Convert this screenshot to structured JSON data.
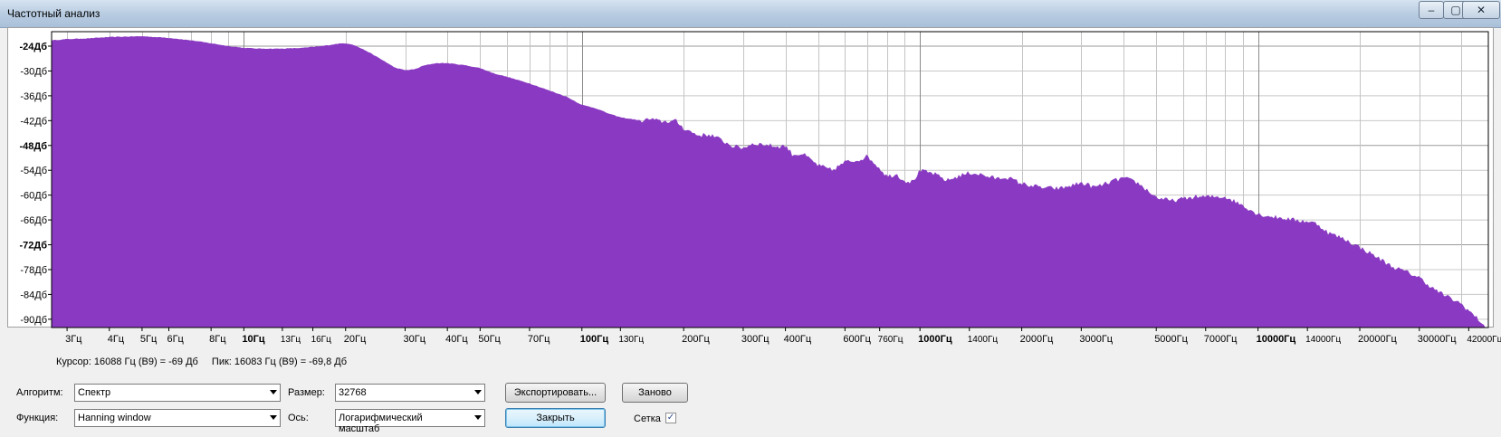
{
  "window": {
    "title": "Частотный анализ"
  },
  "window_buttons": {
    "minimize": "–",
    "maximize": "▢",
    "close": "✕"
  },
  "status": {
    "cursor": "Курсор: 16088 Гц (B9) = -69 Дб",
    "peak": "Пик: 16083 Гц (B9) = -69,8 Дб"
  },
  "controls": {
    "algorithm_label": "Алгоритм:",
    "algorithm_value": "Спектр",
    "function_label": "Функция:",
    "function_value": "Hanning window",
    "size_label": "Размер:",
    "size_value": "32768",
    "axis_label": "Ось:",
    "axis_value": "Логарифмический масштаб",
    "export_label": "Экспортировать...",
    "replot_label": "Заново",
    "close_label": "Закрыть",
    "grid_label": "Сетка",
    "grid_checked": true
  },
  "chart_data": {
    "type": "area",
    "x_scale": "log",
    "xlim": [
      2.7,
      48000
    ],
    "ylim": [
      -92,
      -20.5
    ],
    "grid": true,
    "fill_color": "#8a3ac2",
    "y_ticks": [
      {
        "value": -24,
        "label": "-24Дб",
        "bold": true
      },
      {
        "value": -30,
        "label": "-30Дб",
        "bold": false
      },
      {
        "value": -36,
        "label": "-36Дб",
        "bold": false
      },
      {
        "value": -42,
        "label": "-42Дб",
        "bold": false
      },
      {
        "value": -48,
        "label": "-48Дб",
        "bold": true
      },
      {
        "value": -54,
        "label": "-54Дб",
        "bold": false
      },
      {
        "value": -60,
        "label": "-60Дб",
        "bold": false
      },
      {
        "value": -66,
        "label": "-66Дб",
        "bold": false
      },
      {
        "value": -72,
        "label": "-72Дб",
        "bold": true
      },
      {
        "value": -78,
        "label": "-78Дб",
        "bold": false
      },
      {
        "value": -84,
        "label": "-84Дб",
        "bold": false
      },
      {
        "value": -90,
        "label": "-90Дб",
        "bold": false
      }
    ],
    "x_ticks": [
      {
        "value": 3,
        "label": "3Гц",
        "bold": false
      },
      {
        "value": 4,
        "label": "4Гц",
        "bold": false
      },
      {
        "value": 5,
        "label": "5Гц",
        "bold": false
      },
      {
        "value": 6,
        "label": "6Гц",
        "bold": false
      },
      {
        "value": 8,
        "label": "8Гц",
        "bold": false
      },
      {
        "value": 10,
        "label": "10Гц",
        "bold": true
      },
      {
        "value": 13,
        "label": "13Гц",
        "bold": false
      },
      {
        "value": 16,
        "label": "16Гц",
        "bold": false
      },
      {
        "value": 20,
        "label": "20Гц",
        "bold": false
      },
      {
        "value": 30,
        "label": "30Гц",
        "bold": false
      },
      {
        "value": 40,
        "label": "40Гц",
        "bold": false
      },
      {
        "value": 50,
        "label": "50Гц",
        "bold": false
      },
      {
        "value": 70,
        "label": "70Гц",
        "bold": false
      },
      {
        "value": 100,
        "label": "100Гц",
        "bold": true
      },
      {
        "value": 130,
        "label": "130Гц",
        "bold": false
      },
      {
        "value": 200,
        "label": "200Гц",
        "bold": false
      },
      {
        "value": 300,
        "label": "300Гц",
        "bold": false
      },
      {
        "value": 400,
        "label": "400Гц",
        "bold": false
      },
      {
        "value": 600,
        "label": "600Гц",
        "bold": false
      },
      {
        "value": 760,
        "label": "760Гц",
        "bold": false
      },
      {
        "value": 1000,
        "label": "1000Гц",
        "bold": true
      },
      {
        "value": 1400,
        "label": "1400Гц",
        "bold": false
      },
      {
        "value": 2000,
        "label": "2000Гц",
        "bold": false
      },
      {
        "value": 3000,
        "label": "3000Гц",
        "bold": false
      },
      {
        "value": 5000,
        "label": "5000Гц",
        "bold": false
      },
      {
        "value": 7000,
        "label": "7000Гц",
        "bold": false
      },
      {
        "value": 10000,
        "label": "10000Гц",
        "bold": true
      },
      {
        "value": 14000,
        "label": "14000Гц",
        "bold": false
      },
      {
        "value": 20000,
        "label": "20000Гц",
        "bold": false
      },
      {
        "value": 30000,
        "label": "30000Гц",
        "bold": false
      },
      {
        "value": 42000,
        "label": "42000Гц",
        "bold": false
      }
    ],
    "x_gridlines": [
      3,
      4,
      5,
      6,
      7,
      8,
      9,
      10,
      20,
      30,
      40,
      50,
      60,
      70,
      80,
      90,
      100,
      200,
      300,
      400,
      500,
      600,
      700,
      800,
      900,
      1000,
      2000,
      3000,
      4000,
      5000,
      6000,
      7000,
      8000,
      9000,
      10000,
      20000,
      30000,
      40000
    ],
    "series": [
      {
        "points": [
          [
            2.7,
            -22.6
          ],
          [
            3,
            -22.3
          ],
          [
            3.5,
            -22.1
          ],
          [
            4,
            -21.8
          ],
          [
            5,
            -21.6
          ],
          [
            6,
            -22.0
          ],
          [
            7,
            -22.6
          ],
          [
            8,
            -23.3
          ],
          [
            9,
            -24.0
          ],
          [
            10,
            -24.4
          ],
          [
            11,
            -24.6
          ],
          [
            12,
            -24.6
          ],
          [
            13,
            -24.6
          ],
          [
            14,
            -24.5
          ],
          [
            15,
            -24.4
          ],
          [
            17,
            -24.0
          ],
          [
            19,
            -23.4
          ],
          [
            20,
            -23.3
          ],
          [
            21,
            -23.6
          ],
          [
            23,
            -25.1
          ],
          [
            26,
            -27.6
          ],
          [
            28,
            -29.2
          ],
          [
            30,
            -29.8
          ],
          [
            32,
            -29.6
          ],
          [
            34,
            -28.7
          ],
          [
            37,
            -28.1
          ],
          [
            40,
            -28.1
          ],
          [
            45,
            -28.6
          ],
          [
            50,
            -29.3
          ],
          [
            55,
            -30.6
          ],
          [
            60,
            -31.4
          ],
          [
            70,
            -33.0
          ],
          [
            80,
            -34.7
          ],
          [
            90,
            -36.2
          ],
          [
            100,
            -38.2
          ],
          [
            110,
            -39.0
          ],
          [
            120,
            -40.3
          ],
          [
            130,
            -41.2
          ],
          [
            140,
            -41.6
          ],
          [
            150,
            -42.0
          ],
          [
            160,
            -41.6
          ],
          [
            170,
            -42.2
          ],
          [
            190,
            -42.1
          ],
          [
            200,
            -43.8
          ],
          [
            220,
            -45.5
          ],
          [
            240,
            -45.4
          ],
          [
            260,
            -46.8
          ],
          [
            280,
            -48.2
          ],
          [
            300,
            -48.6
          ],
          [
            320,
            -47.5
          ],
          [
            350,
            -47.8
          ],
          [
            380,
            -48.3
          ],
          [
            400,
            -48.0
          ],
          [
            420,
            -50.2
          ],
          [
            450,
            -50.0
          ],
          [
            500,
            -52.8
          ],
          [
            550,
            -54.0
          ],
          [
            600,
            -52.0
          ],
          [
            650,
            -51.6
          ],
          [
            700,
            -50.6
          ],
          [
            760,
            -53.5
          ],
          [
            800,
            -55.5
          ],
          [
            850,
            -54.9
          ],
          [
            900,
            -56.5
          ],
          [
            950,
            -56.8
          ],
          [
            1000,
            -54.1
          ],
          [
            1100,
            -54.8
          ],
          [
            1200,
            -56.5
          ],
          [
            1300,
            -55.4
          ],
          [
            1400,
            -54.6
          ],
          [
            1500,
            -54.9
          ],
          [
            1600,
            -55.6
          ],
          [
            1700,
            -56.0
          ],
          [
            1800,
            -55.6
          ],
          [
            2000,
            -57.2
          ],
          [
            2300,
            -58.2
          ],
          [
            2600,
            -58.4
          ],
          [
            3000,
            -57.0
          ],
          [
            3300,
            -58.1
          ],
          [
            3600,
            -57.0
          ],
          [
            4000,
            -55.8
          ],
          [
            4400,
            -57.0
          ],
          [
            4700,
            -58.8
          ],
          [
            5000,
            -60.5
          ],
          [
            5500,
            -61.4
          ],
          [
            6000,
            -60.9
          ],
          [
            6500,
            -60.4
          ],
          [
            7000,
            -60.4
          ],
          [
            8000,
            -60.4
          ],
          [
            9000,
            -62.4
          ],
          [
            10000,
            -64.6
          ],
          [
            11000,
            -65.2
          ],
          [
            12000,
            -65.6
          ],
          [
            13000,
            -66.1
          ],
          [
            14000,
            -66.3
          ],
          [
            15000,
            -67.0
          ],
          [
            16088,
            -69.0
          ],
          [
            17000,
            -69.8
          ],
          [
            18000,
            -70.6
          ],
          [
            20000,
            -72.6
          ],
          [
            22000,
            -74.5
          ],
          [
            25000,
            -77.3
          ],
          [
            28000,
            -78.8
          ],
          [
            30000,
            -79.9
          ],
          [
            33000,
            -82.6
          ],
          [
            36000,
            -84.4
          ],
          [
            40000,
            -86.3
          ],
          [
            44000,
            -89.4
          ],
          [
            47000,
            -91.6
          ]
        ]
      }
    ]
  }
}
